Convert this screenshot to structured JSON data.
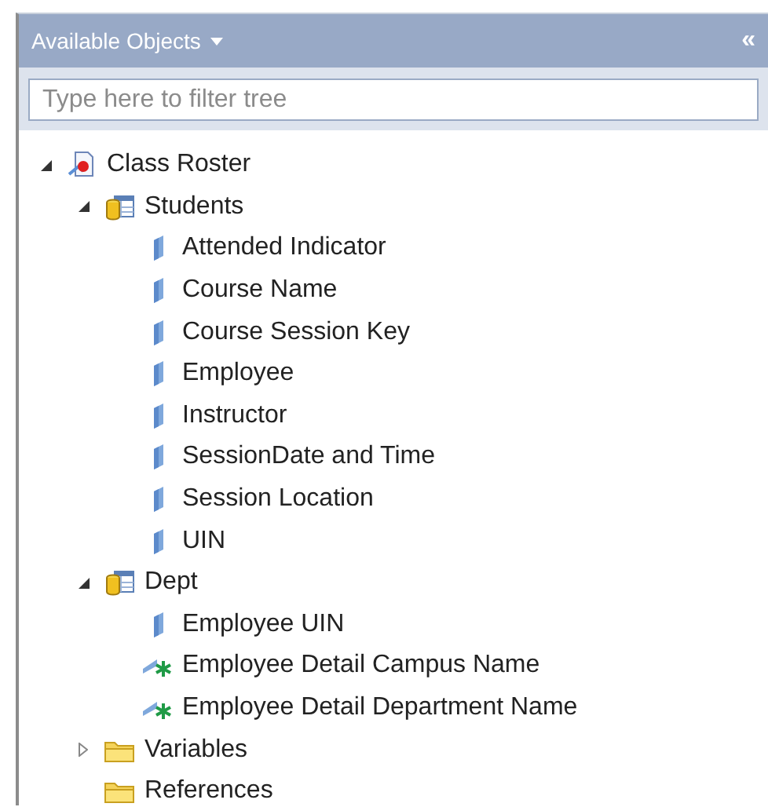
{
  "panel": {
    "title": "Available Objects",
    "collapse_glyph": "«"
  },
  "filter": {
    "placeholder": "Type here to filter tree"
  },
  "tree": [
    {
      "label": "Class Roster",
      "kind": "report",
      "expanded": true,
      "children": [
        {
          "label": "Students",
          "kind": "table",
          "expanded": true,
          "children": [
            {
              "label": "Attended Indicator",
              "kind": "dimension"
            },
            {
              "label": "Course Name",
              "kind": "dimension"
            },
            {
              "label": "Course Session Key",
              "kind": "dimension"
            },
            {
              "label": "Employee",
              "kind": "dimension"
            },
            {
              "label": "Instructor",
              "kind": "dimension"
            },
            {
              "label": "SessionDate and Time",
              "kind": "dimension"
            },
            {
              "label": "Session Location",
              "kind": "dimension"
            },
            {
              "label": "UIN",
              "kind": "dimension"
            }
          ]
        },
        {
          "label": "Dept",
          "kind": "table",
          "expanded": true,
          "children": [
            {
              "label": "Employee UIN",
              "kind": "dimension"
            },
            {
              "label": "Employee Detail Campus Name",
              "kind": "detail"
            },
            {
              "label": "Employee Detail Department Name",
              "kind": "detail"
            }
          ]
        },
        {
          "label": "Variables",
          "kind": "folder",
          "expanded": false
        },
        {
          "label": "References",
          "kind": "folder"
        }
      ]
    }
  ]
}
